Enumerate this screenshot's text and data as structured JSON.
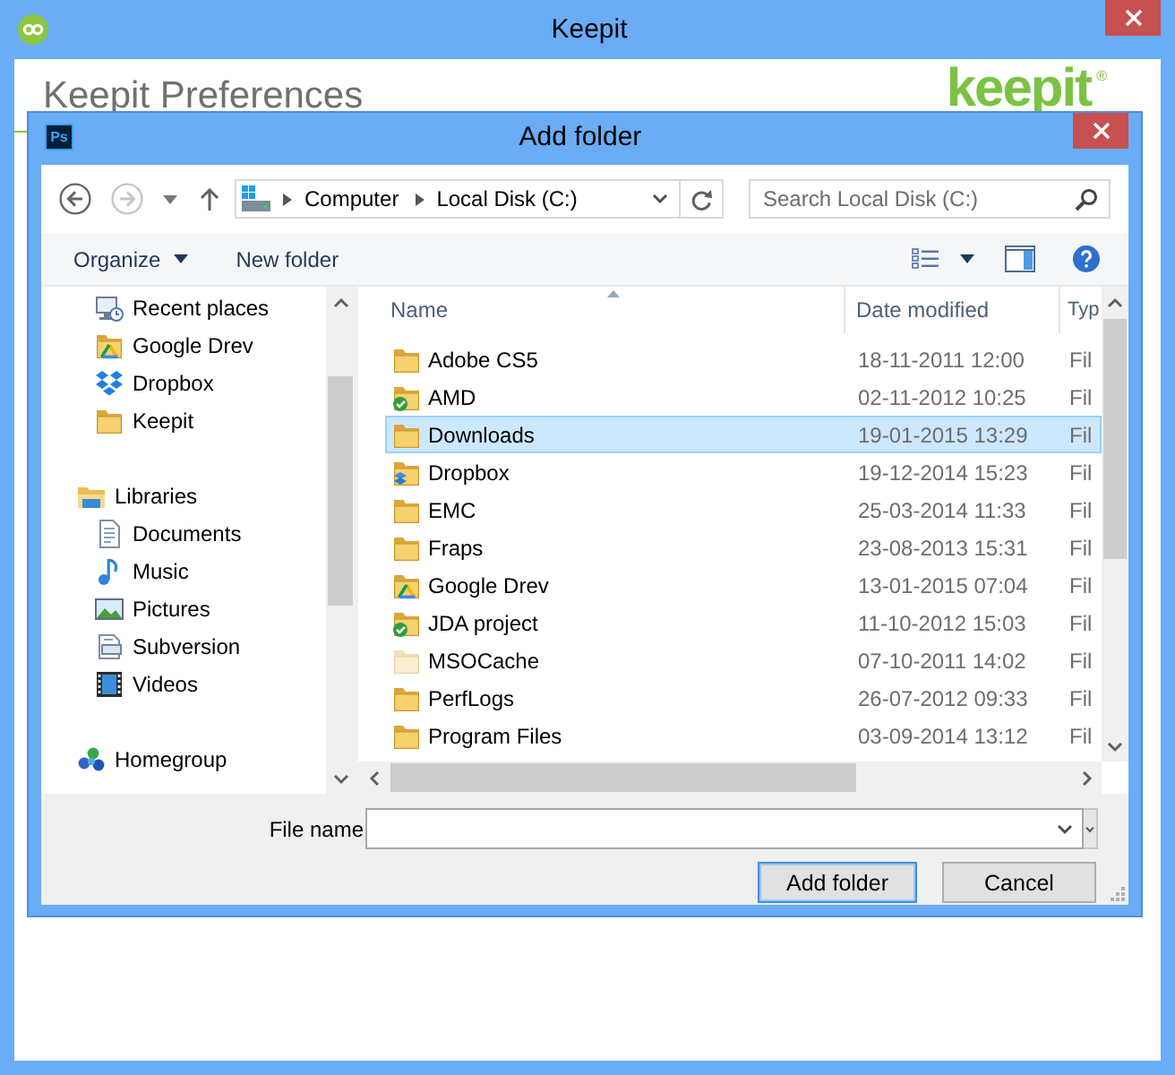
{
  "window": {
    "title": "Keepit"
  },
  "preferences": {
    "heading": "Keepit Preferences",
    "logo": "keepit$^{®}$"
  },
  "dialog": {
    "title": "Add folder",
    "app_icon_text": "Ps",
    "nav_buttons": [
      {
        "kind": "back",
        "disabled": false
      },
      {
        "kind": "forward",
        "disabled": true
      }
    ],
    "address": {
      "path": [
        "Computer",
        "Local Disk (C:)"
      ]
    },
    "search": {
      "placeholder": "Search Local Disk (C:)"
    },
    "toolbar": {
      "organize": "Organize",
      "new_folder": "New folder"
    },
    "nav_pane": {
      "sections": [
        {
          "children": [
            {
              "label": "Recent places",
              "kind": "recent"
            },
            {
              "label": "Google Drev",
              "kind": "drive"
            },
            {
              "label": "Dropbox",
              "kind": "dropbox"
            },
            {
              "label": "Keepit",
              "kind": "folder"
            }
          ]
        },
        {
          "label": "Libraries",
          "kind": "libraries",
          "children": [
            {
              "label": "Documents",
              "kind": "documents"
            },
            {
              "label": "Music",
              "kind": "music"
            },
            {
              "label": "Pictures",
              "kind": "pictures"
            },
            {
              "label": "Subversion",
              "kind": "subversion"
            },
            {
              "label": "Videos",
              "kind": "videos"
            }
          ]
        },
        {
          "label": "Homegroup",
          "kind": "homegroup"
        }
      ]
    },
    "file_list": {
      "columns": [
        {
          "label": "Name",
          "sorted": true
        },
        {
          "label": "Date modified",
          "sorted": false
        },
        {
          "label": "Typ",
          "sorted": false
        }
      ],
      "rows": [
        {
          "name": "Adobe CS5",
          "date_modified": "18-11-2011 12:00",
          "type": "Fil",
          "kind": "folder",
          "selected": false
        },
        {
          "name": "AMD",
          "date_modified": "02-11-2012 10:25",
          "type": "Fil",
          "kind": "synced",
          "selected": false
        },
        {
          "name": "Downloads",
          "date_modified": "19-01-2015 13:29",
          "type": "Fil",
          "kind": "folder",
          "selected": true
        },
        {
          "name": "Dropbox",
          "date_modified": "19-12-2014 15:23",
          "type": "Fil",
          "kind": "dropbox",
          "selected": false
        },
        {
          "name": "EMC",
          "date_modified": "25-03-2014 11:33",
          "type": "Fil",
          "kind": "folder",
          "selected": false
        },
        {
          "name": "Fraps",
          "date_modified": "23-08-2013 15:31",
          "type": "Fil",
          "kind": "folder",
          "selected": false
        },
        {
          "name": "Google Drev",
          "date_modified": "13-01-2015 07:04",
          "type": "Fil",
          "kind": "drive",
          "selected": false
        },
        {
          "name": "JDA project",
          "date_modified": "11-10-2012 15:03",
          "type": "Fil",
          "kind": "synced",
          "selected": false
        },
        {
          "name": "MSOCache",
          "date_modified": "07-10-2011 14:02",
          "type": "Fil",
          "kind": "hidden",
          "selected": false
        },
        {
          "name": "PerfLogs",
          "date_modified": "26-07-2012 09:33",
          "type": "Fil",
          "kind": "folder",
          "selected": false
        },
        {
          "name": "Program Files",
          "date_modified": "03-09-2014 13:12",
          "type": "Fil",
          "kind": "folder",
          "selected": false
        }
      ]
    },
    "file_name": {
      "label": "File name"
    },
    "buttons": [
      {
        "label": "Add folder",
        "focused": true
      },
      {
        "label": "Cancel",
        "focused": false
      }
    ]
  }
}
